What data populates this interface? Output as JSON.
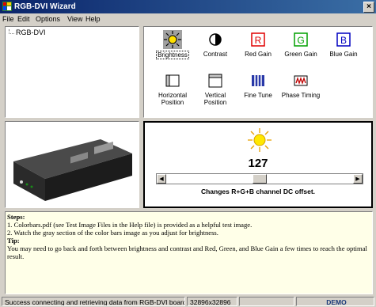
{
  "window": {
    "title": "RGB-DVI Wizard",
    "close_label": "×"
  },
  "menu": {
    "items": [
      "File",
      "Edit",
      "Options",
      "View",
      "Help"
    ]
  },
  "tree": {
    "items": [
      "RGB-DVI"
    ]
  },
  "tools": [
    {
      "label": "Brightness",
      "icon": "brightness-icon",
      "selected": true
    },
    {
      "label": "Contrast",
      "icon": "contrast-icon"
    },
    {
      "label": "Red Gain",
      "icon": "red-gain-icon",
      "letter": "R",
      "color": "#e00000"
    },
    {
      "label": "Green Gain",
      "icon": "green-gain-icon",
      "letter": "G",
      "color": "#00a000"
    },
    {
      "label": "Blue Gain",
      "icon": "blue-gain-icon",
      "letter": "B",
      "color": "#0000c0"
    },
    {
      "label": "Horizontal Position",
      "icon": "horizontal-position-icon"
    },
    {
      "label": "Vertical Position",
      "icon": "vertical-position-icon"
    },
    {
      "label": "Fine Tune",
      "icon": "fine-tune-icon"
    },
    {
      "label": "Phase Timing",
      "icon": "phase-timing-icon"
    }
  ],
  "adjust": {
    "value": "127",
    "slider_fraction": 0.5,
    "caption": "Changes R+G+B channel DC offset."
  },
  "help": {
    "steps_heading": "Steps:",
    "steps": [
      "1.  Colorbars.pdf (see Test Image Files in the Help file) is provided as a helpful test image.",
      "2.  Watch the gray section of the color bars image as you adjust for brightness."
    ],
    "tip_heading": "Tip:",
    "tip": "You may need to go back and forth between brightness and contrast and Red, Green, and Blue Gain a few times to reach the optimal result."
  },
  "status": {
    "message": "Success connecting and retrieving data from RGB-DVI board.",
    "resolution": "32896x32896",
    "mode": "",
    "badge": "DEMO"
  },
  "colors": {
    "title_start": "#0a246a",
    "title_end": "#3a6ea5",
    "help_bg": "#ffffe8"
  }
}
